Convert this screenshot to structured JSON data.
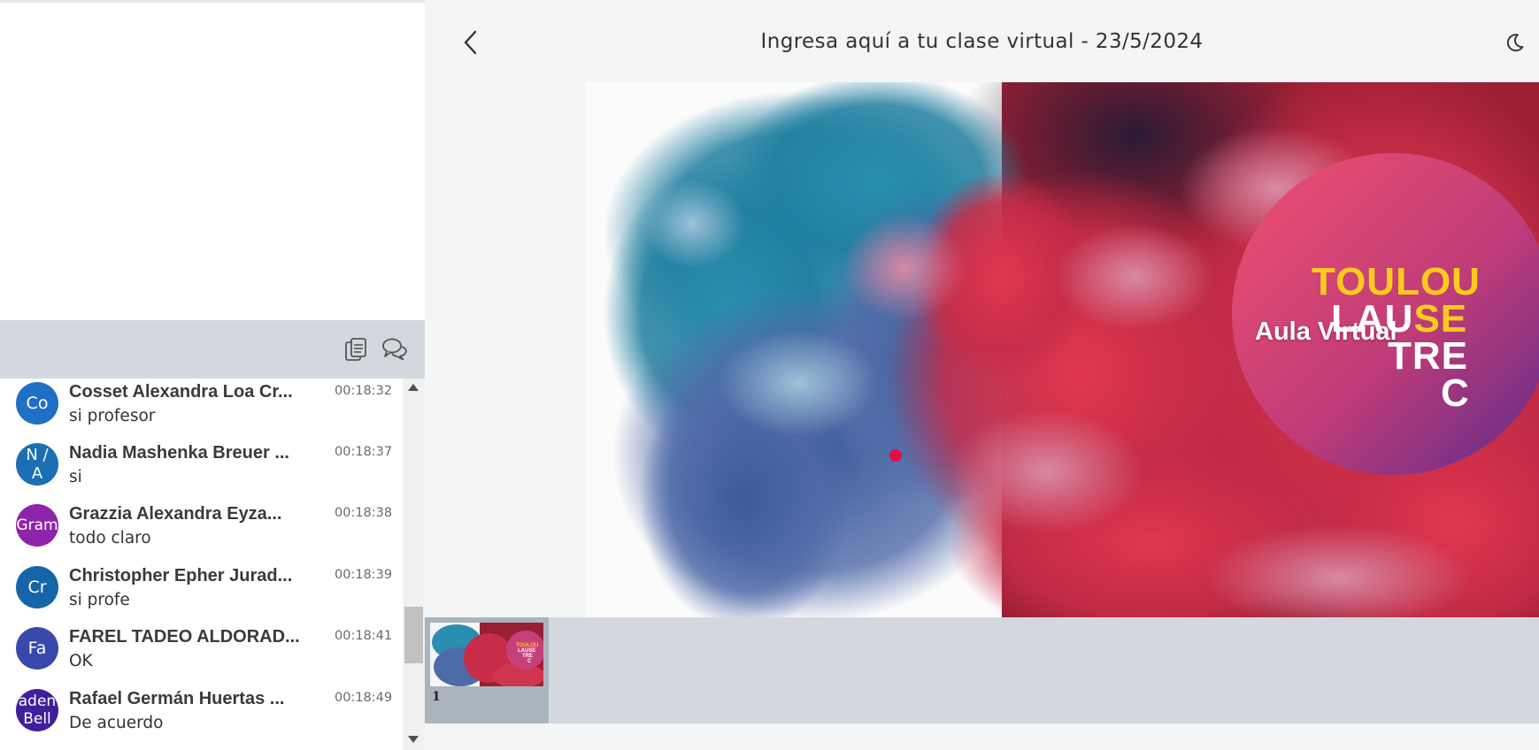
{
  "header": {
    "title": "Ingresa aquí a tu clase virtual - 23/5/2024",
    "back_icon": "chevron-left-icon",
    "theme_icon": "moon-icon"
  },
  "chat_toolbar": {
    "icons": [
      "clipboard-icon",
      "chat-bubbles-icon"
    ]
  },
  "chat": {
    "messages": [
      {
        "initials": "Co",
        "avatar_color": "#1f6fc5",
        "sender": "Cosset Alexandra Loa Cr...",
        "time": "00:18:32",
        "text": "si profesor"
      },
      {
        "initials": "N / A",
        "avatar_color": "#1a6fb5",
        "sender": "Nadia Mashenka Breuer ...",
        "time": "00:18:37",
        "text": "si"
      },
      {
        "initials": "Gram",
        "avatar_color": "#8e24aa",
        "sender": "Grazzia Alexandra Eyza...",
        "time": "00:18:38",
        "text": "todo claro"
      },
      {
        "initials": "Cr",
        "avatar_color": "#1565a8",
        "sender": "Christopher Epher Jurad...",
        "time": "00:18:39",
        "text": "si profe"
      },
      {
        "initials": "Fa",
        "avatar_color": "#3949ab",
        "sender": "FAREL TADEO ALDORAD...",
        "time": "00:18:41",
        "text": "OK"
      },
      {
        "initials": "aden Bell",
        "avatar_color": "#3f1f9a",
        "sender": "Rafael Germán Huertas ...",
        "time": "00:18:49",
        "text": "De acuerdo"
      }
    ]
  },
  "slide": {
    "label": "Aula Virtual",
    "logo_lines": [
      "TOULOU",
      "LAUSE",
      "TRE",
      "C"
    ],
    "colors": {
      "logo_yellow": "#ffcc1d",
      "logo_white": "#ffffff",
      "pointer": "#e30b4a"
    }
  },
  "thumbnails": [
    {
      "number": "1"
    }
  ]
}
